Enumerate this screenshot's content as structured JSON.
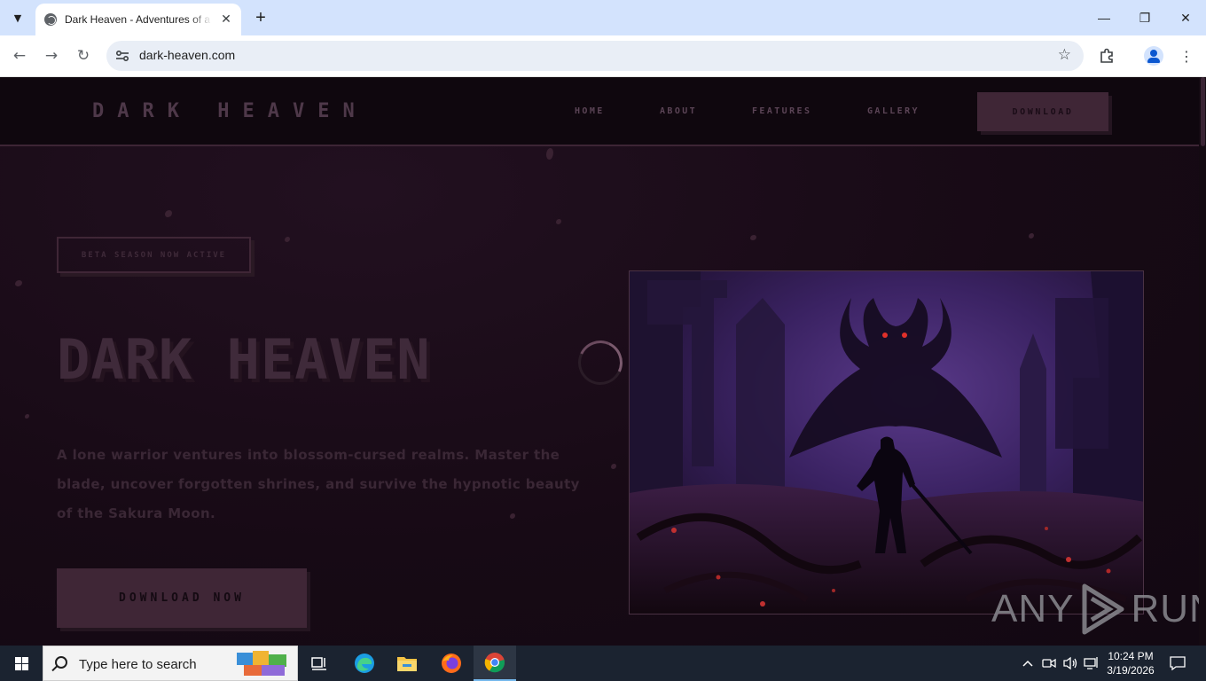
{
  "browser": {
    "tab_title": "Dark Heaven - Adventures of a",
    "tab_close": "✕",
    "new_tab": "+",
    "url": "dark-heaven.com",
    "window_controls": {
      "minimize": "—",
      "maximize": "❐",
      "close": "✕"
    }
  },
  "site": {
    "logo": "DARK HEAVEN",
    "nav": [
      {
        "label": "HOME"
      },
      {
        "label": "ABOUT"
      },
      {
        "label": "FEATURES"
      },
      {
        "label": "GALLERY"
      }
    ],
    "download_label": "DOWNLOAD"
  },
  "hero": {
    "badge": "BETA SEASON NOW ACTIVE",
    "title": "DARK HEAVEN",
    "description": "A lone warrior ventures into blossom-cursed realms. Master the blade, uncover forgotten shrines, and survive the hypnotic beauty of the Sakura Moon.",
    "cta": "DOWNLOAD NOW",
    "artwork_icon": "warrior-demon-ruins-artwork"
  },
  "watermark": {
    "left": "ANY",
    "right": "RUN"
  },
  "taskbar": {
    "search_placeholder": "Type here to search",
    "time": "10:24 PM",
    "date": "3/19/2026",
    "apps": [
      "task-view",
      "edge",
      "file-explorer",
      "firefox",
      "chrome"
    ]
  },
  "colors": {
    "page_bg": "#170a15",
    "accent": "#3f2636",
    "text_muted": "#5b4456"
  }
}
